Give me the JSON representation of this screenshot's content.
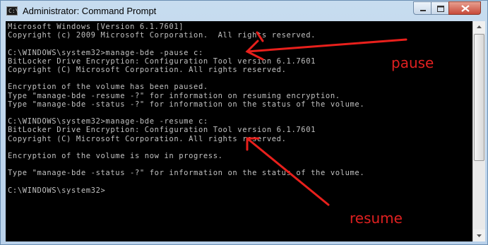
{
  "window": {
    "title": "Administrator: Command Prompt",
    "app_icon_text": "C:\\"
  },
  "console": {
    "lines": [
      "Microsoft Windows [Version 6.1.7601]",
      "Copyright (c) 2009 Microsoft Corporation.  All rights reserved.",
      "",
      "C:\\WINDOWS\\system32>manage-bde -pause c:",
      "BitLocker Drive Encryption: Configuration Tool version 6.1.7601",
      "Copyright (C) Microsoft Corporation. All rights reserved.",
      "",
      "Encryption of the volume has been paused.",
      "Type \"manage-bde -resume -?\" for information on resuming encryption.",
      "Type \"manage-bde -status -?\" for information on the status of the volume.",
      "",
      "C:\\WINDOWS\\system32>manage-bde -resume c:",
      "BitLocker Drive Encryption: Configuration Tool version 6.1.7601",
      "Copyright (C) Microsoft Corporation. All rights reserved.",
      "",
      "Encryption of the volume is now in progress.",
      "",
      "Type \"manage-bde -status -?\" for information on the status of the volume.",
      "",
      "C:\\WINDOWS\\system32>"
    ]
  },
  "annotations": {
    "pause_label": "pause",
    "resume_label": "resume",
    "color": "#e02020"
  },
  "colors": {
    "console_background": "#000000",
    "console_text": "#c0c0c0"
  }
}
